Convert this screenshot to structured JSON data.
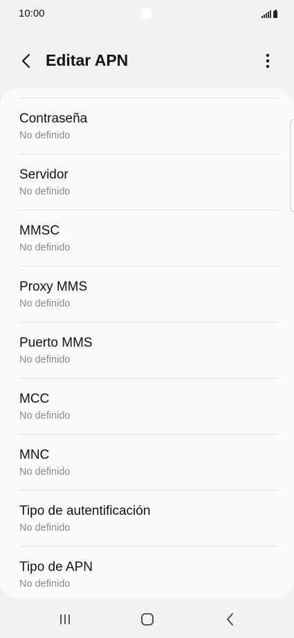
{
  "status_bar": {
    "time": "10:00"
  },
  "header": {
    "title": "Editar APN",
    "back_icon": "chevron-left-icon",
    "more_icon": "more-vertical-icon"
  },
  "apn_fields": [
    {
      "label": "Contraseña",
      "value": "No definido"
    },
    {
      "label": "Servidor",
      "value": "No definido"
    },
    {
      "label": "MMSC",
      "value": "No definido"
    },
    {
      "label": "Proxy MMS",
      "value": "No definido"
    },
    {
      "label": "Puerto MMS",
      "value": "No definido"
    },
    {
      "label": "MCC",
      "value": "No definido"
    },
    {
      "label": "MNC",
      "value": "No definido"
    },
    {
      "label": "Tipo de autentificación",
      "value": "No definido"
    },
    {
      "label": "Tipo de APN",
      "value": "No definido"
    }
  ],
  "nav_bar": {
    "recents_icon": "recents-icon",
    "home_icon": "home-icon",
    "back_icon": "back-icon"
  },
  "colors": {
    "background": "#f2f2f2",
    "card": "#fafafa",
    "primary_text": "#111111",
    "secondary_text": "#8a8a8a",
    "divider": "#e3e3e3"
  }
}
